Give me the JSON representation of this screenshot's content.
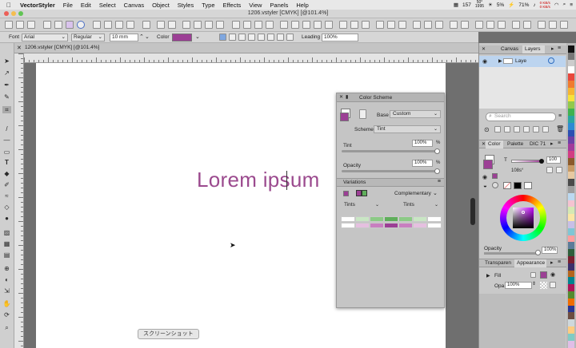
{
  "menubar": {
    "apple": "",
    "app_name": "VectorStyler",
    "items": [
      "File",
      "Edit",
      "Select",
      "Canvas",
      "Object",
      "Styles",
      "Type",
      "Effects",
      "View",
      "Panels",
      "Help"
    ],
    "status": {
      "cpu": "157",
      "temp": "50°",
      "rpm": "1995",
      "battery_pct": "5%",
      "volume_pct": "71%",
      "net_up": "0 KB/s",
      "net_down": "0 KB/s"
    }
  },
  "window": {
    "title": "1206.vstyler [CMYK] [@101.4%]",
    "doc_tab": "1206.vstyler [CMYK] [@101.4%]"
  },
  "text_toolbar": {
    "font_label": "Font",
    "font_value": "Arial",
    "weight_value": "Regular",
    "size_value": "10 mm",
    "color_label": "Color",
    "color_value": "#9c3f95",
    "leading_label": "Leading",
    "leading_value": "100%"
  },
  "canvas": {
    "text": "Lorem ipsum",
    "text_color": "#9b4a8e"
  },
  "screenshot_button": "スクリーンショット",
  "color_scheme_panel": {
    "title": "Color Scheme",
    "base_label": "Base",
    "base_value": "Custom",
    "scheme_label": "Scheme",
    "scheme_value": "Tint",
    "tint_label": "Tint",
    "tint_value": "100%",
    "tint_unit": "%",
    "opacity_label": "Opacity",
    "opacity_value": "100%",
    "opacity_unit": "%",
    "variations_title": "Variations",
    "variation_mode": "Complementary",
    "left_dropdown": "Tints",
    "right_dropdown": "Tints",
    "rows": [
      [
        "#ffffff",
        "#c9e6c4",
        "#8cca86",
        "#5fae5b",
        "#8cca86",
        "#c9e6c4",
        "#ffffff"
      ],
      [
        "#ffffff",
        "#e5c0e0",
        "#c87ec0",
        "#9c3f95",
        "#c87ec0",
        "#e5c0e0",
        "#ffffff"
      ]
    ]
  },
  "right_panel": {
    "tabs_top": [
      "Canvas",
      "Layers"
    ],
    "layer_name": "Laye",
    "search_placeholder": "Search",
    "color_tabs": [
      "Color",
      "Palette",
      "DIC 71"
    ],
    "t_value": "100",
    "angle_value": "108s°",
    "opacity_label": "Opacity",
    "opacity_value": "100%",
    "tabs_bottom": [
      "Transparen",
      "Appearance"
    ],
    "fill_label": "Fill",
    "opa_label": "Opa",
    "opa_value": "100%",
    "accent": "#9c3f95"
  },
  "palette_colors": [
    "#111111",
    "#777777",
    "#cccccc",
    "#ffffff",
    "#e8473c",
    "#f07b2e",
    "#f6b531",
    "#f7e23b",
    "#92c94b",
    "#3fb24f",
    "#2aa5a0",
    "#2d8bd3",
    "#2c4fb2",
    "#6c3fa6",
    "#a23a9b",
    "#d23d83",
    "#8b5a2b",
    "#c89a64",
    "#e8c9a1",
    "#4a4a4a",
    "#9e9e9e",
    "#bcd9f1",
    "#f5c3d1",
    "#d6e9b3",
    "#fbe7a4",
    "#c8bfe7",
    "#7fc6d5",
    "#ff9e9e",
    "#5b7c99",
    "#2e5e3a",
    "#7a1f2f",
    "#3c2f6b",
    "#b5651d",
    "#00838f",
    "#ad1457",
    "#558b2f",
    "#ef6c00",
    "#283593",
    "#6d4c41",
    "#cfd8dc",
    "#ffcc80",
    "#80cbc4",
    "#e1bee7"
  ]
}
